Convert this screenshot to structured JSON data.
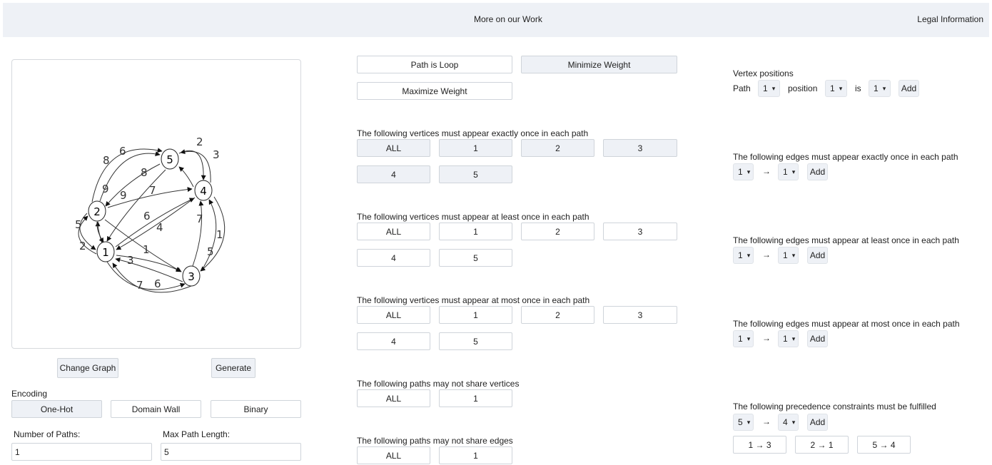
{
  "nav": {
    "more_work": "More on our Work",
    "legal": "Legal Information"
  },
  "graph": {
    "vertices": [
      "1",
      "2",
      "3",
      "4",
      "5"
    ],
    "edge_labels": [
      "8",
      "6",
      "2",
      "3",
      "8",
      "9",
      "7",
      "6",
      "4",
      "1",
      "3",
      "7",
      "6",
      "7",
      "5",
      "1",
      "5",
      "2",
      "9"
    ]
  },
  "left": {
    "change_graph": "Change Graph",
    "generate": "Generate",
    "encoding_label": "Encoding",
    "encodings": [
      "One-Hot",
      "Domain Wall",
      "Binary"
    ],
    "num_paths_label": "Number of Paths:",
    "num_paths_value": "1",
    "max_len_label": "Max Path Length:",
    "max_len_value": "5"
  },
  "middle": {
    "path_is_loop": "Path is Loop",
    "minimize_weight": "Minimize Weight",
    "maximize_weight": "Maximize Weight",
    "exactly_once": "The following vertices must appear exactly once in each path",
    "at_least_once": "The following vertices must appear at least once in each path",
    "at_most_once": "The following vertices must appear at most once in each path",
    "not_share_vertices": "The following paths may not share vertices",
    "not_share_edges": "The following paths may not share edges",
    "vertex_buttons": [
      "ALL",
      "1",
      "2",
      "3",
      "4",
      "5"
    ],
    "path_buttons": [
      "ALL",
      "1"
    ]
  },
  "right": {
    "vertex_positions": "Vertex positions",
    "path_label": "Path",
    "path_value": "1",
    "position_label": "position",
    "position_value": "1",
    "is_label": "is",
    "is_value": "1",
    "add": "Add",
    "edges_exactly": "The following edges must appear exactly once in each path",
    "edges_at_least": "The following edges must appear at least once in each path",
    "edges_at_most": "The following edges must appear at most once in each path",
    "precedence": "The following precedence constraints must be fulfilled",
    "edge_from": "1",
    "edge_to": "1",
    "prec_from": "5",
    "prec_to": "4",
    "arrow": "→",
    "prec_items": [
      "1 → 3",
      "2 → 1",
      "5 → 4"
    ]
  }
}
